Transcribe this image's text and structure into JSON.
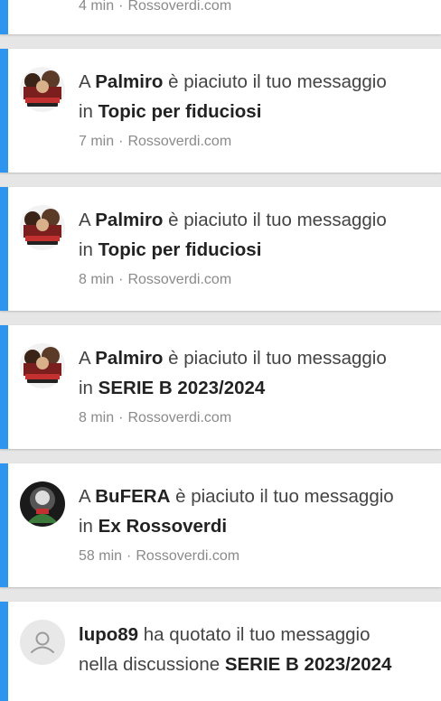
{
  "notifications": [
    {
      "time": "4 min",
      "source": "Rossoverdi.com",
      "unread": true
    },
    {
      "prefix": "A",
      "user": "Palmiro",
      "action": "è piaciuto il tuo messaggio",
      "connector": "in",
      "topic": "Topic per fiduciosi",
      "time": "7 min",
      "source": "Rossoverdi.com",
      "avatar": "palmiro-avatar",
      "unread": true
    },
    {
      "prefix": "A",
      "user": "Palmiro",
      "action": "è piaciuto il tuo messaggio",
      "connector": "in",
      "topic": "Topic per fiduciosi",
      "time": "8 min",
      "source": "Rossoverdi.com",
      "avatar": "palmiro-avatar",
      "unread": true
    },
    {
      "prefix": "A",
      "user": "Palmiro",
      "action": "è piaciuto il tuo messaggio",
      "connector": "in",
      "topic": "SERIE B 2023/2024",
      "time": "8 min",
      "source": "Rossoverdi.com",
      "avatar": "palmiro-avatar",
      "unread": true
    },
    {
      "prefix": "A",
      "user": "BuFERA",
      "action": "è piaciuto il tuo messaggio",
      "connector": "in",
      "topic": "Ex Rossoverdi",
      "time": "58 min",
      "source": "Rossoverdi.com",
      "avatar": "bufera-avatar",
      "unread": true
    },
    {
      "user": "lupo89",
      "action": "ha quotato il tuo messaggio",
      "connector": "nella discussione",
      "topic": "SERIE B 2023/2024",
      "avatar": "default-user-icon",
      "unread": true
    }
  ],
  "meta_separator": "·",
  "colors": {
    "accent": "#2d95ee",
    "background": "#e6e6e6",
    "card": "#ffffff"
  }
}
